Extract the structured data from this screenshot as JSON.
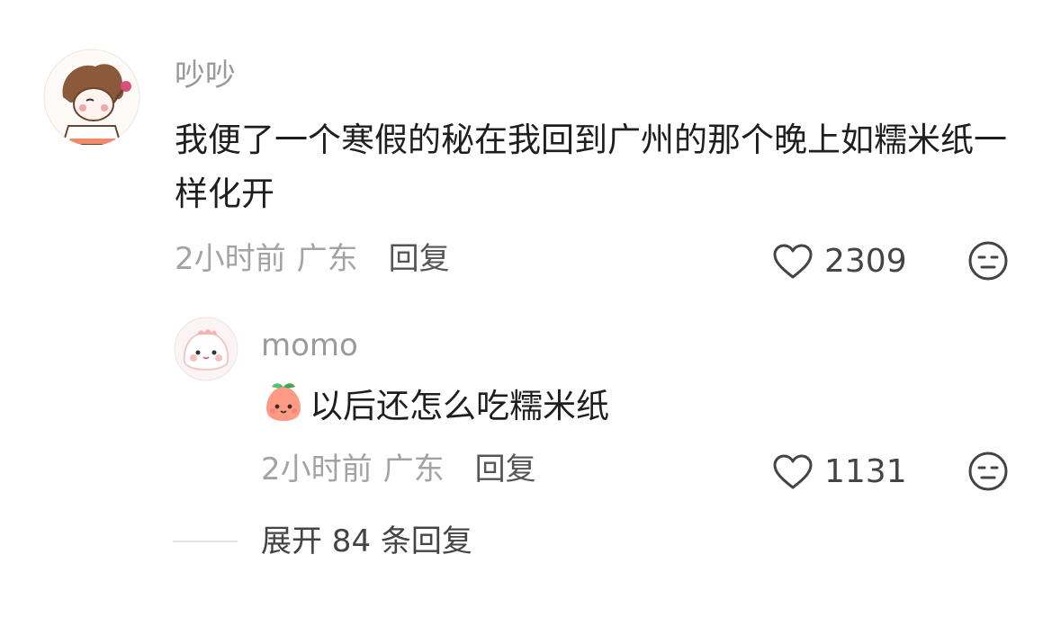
{
  "comments": [
    {
      "username": "吵吵",
      "text": "我便了一个寒假的秘在我回到广州的那个晚上如糯米纸一样化开",
      "time": "2小时前",
      "location": "广东",
      "reply_label": "回复",
      "likes": "2309",
      "icons": {
        "like": "heart-outline-icon",
        "dislike": "neutral-face-icon"
      },
      "replies": [
        {
          "username": "momo",
          "emoji": "peach-face-emoji",
          "text": "以后还怎么吃糯米纸",
          "time": "2小时前",
          "location": "广东",
          "reply_label": "回复",
          "likes": "1131",
          "icons": {
            "like": "heart-outline-icon",
            "dislike": "neutral-face-icon"
          }
        }
      ],
      "expand_label": "展开 84 条回复"
    }
  ],
  "colors": {
    "username": "#9a9a9a",
    "text": "#1e1e1e",
    "meta": "#a3a3a3",
    "action": "#555555"
  }
}
